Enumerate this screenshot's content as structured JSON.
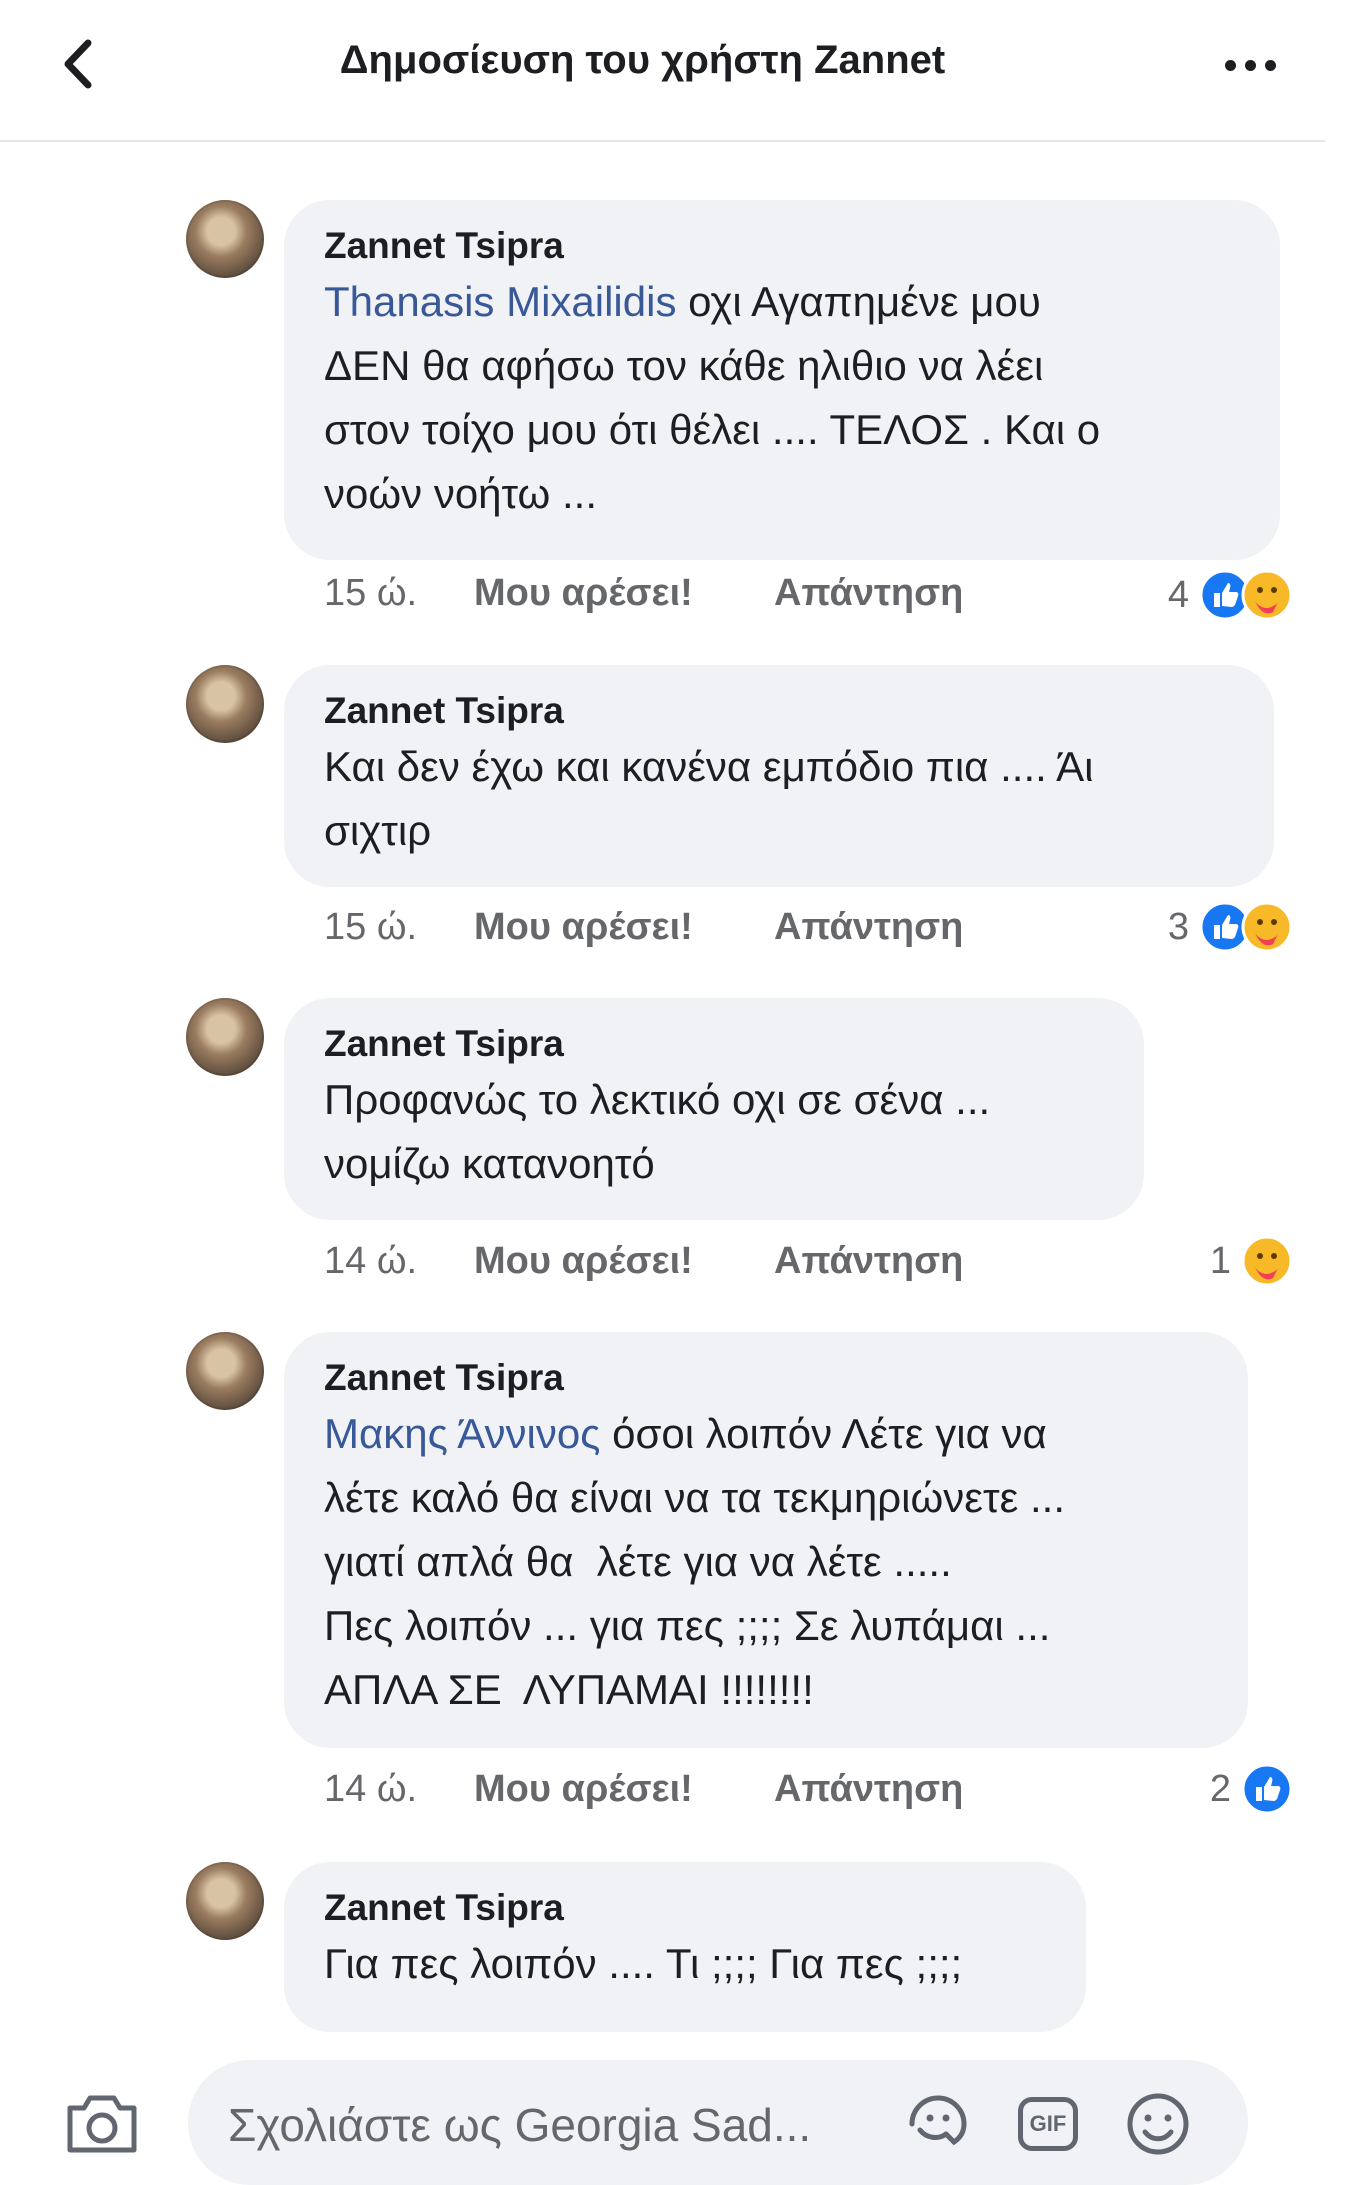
{
  "header": {
    "title": "Δημοσίευση του χρήστη Zannet",
    "back_icon": "chevron-left-icon",
    "more_icon": "more-horizontal-icon"
  },
  "comments": [
    {
      "author": "Zannet Tsipra",
      "mention": "Thanasis Mixailidis",
      "text": " οχι Αγαπημένε μου\nΔΕΝ θα αφήσω τον κάθε ηλιθιο να λέει\nστον τοίχο μου ότι θέλει .... ΤΕΛΟΣ . Και ο\nνοών νοήτω ...",
      "time": "15 ώ.",
      "like": "Μου αρέσει!",
      "reply": "Απάντηση",
      "reaction_count": "4",
      "reactions": [
        "like",
        "care"
      ]
    },
    {
      "author": "Zannet Tsipra",
      "mention": "",
      "text": "Και δεν έχω και κανένα εμπόδιο πια .... Άι\nσιχτιρ",
      "time": "15 ώ.",
      "like": "Μου αρέσει!",
      "reply": "Απάντηση",
      "reaction_count": "3",
      "reactions": [
        "like",
        "care"
      ]
    },
    {
      "author": "Zannet Tsipra",
      "mention": "",
      "text": "Προφανώς το λεκτικό οχι σε σένα ...\nνομίζω κατανοητό",
      "time": "14 ώ.",
      "like": "Μου αρέσει!",
      "reply": "Απάντηση",
      "reaction_count": "1",
      "reactions": [
        "care"
      ]
    },
    {
      "author": "Zannet Tsipra",
      "mention": "Μακης Άννινος",
      "text": " όσοι λοιπόν Λέτε για να\nλέτε καλό θα είναι να τα τεκμηριώνετε ...\nγιατί απλά θα  λέτε για να λέτε .....\nΠες λοιπόν ... για πες ;;;; Σε λυπάμαι ...\nΑΠΛΑ ΣΕ  ΛΥΠΑΜΑΙ !!!!!!!!",
      "time": "14 ώ.",
      "like": "Μου αρέσει!",
      "reply": "Απάντηση",
      "reaction_count": "2",
      "reactions": [
        "like"
      ]
    },
    {
      "author": "Zannet Tsipra",
      "mention": "",
      "text": "Για πες λοιπόν .... Τι ;;;; Για πες ;;;;",
      "time": "",
      "like": "",
      "reply": "",
      "reaction_count": "",
      "reactions": []
    }
  ],
  "composer": {
    "placeholder": "Σχολιάστε ως Georgia Sad...",
    "gif_label": "GIF",
    "icons": [
      "camera-icon",
      "sticker-icon",
      "gif-icon",
      "emoji-icon"
    ]
  },
  "colors": {
    "like_blue": "#1877f2",
    "care_yellow": "#f7b928",
    "care_red": "#f33e58",
    "mention_blue": "#385898",
    "bubble_bg": "#f0f2f5",
    "meta_gray": "#65676b"
  }
}
